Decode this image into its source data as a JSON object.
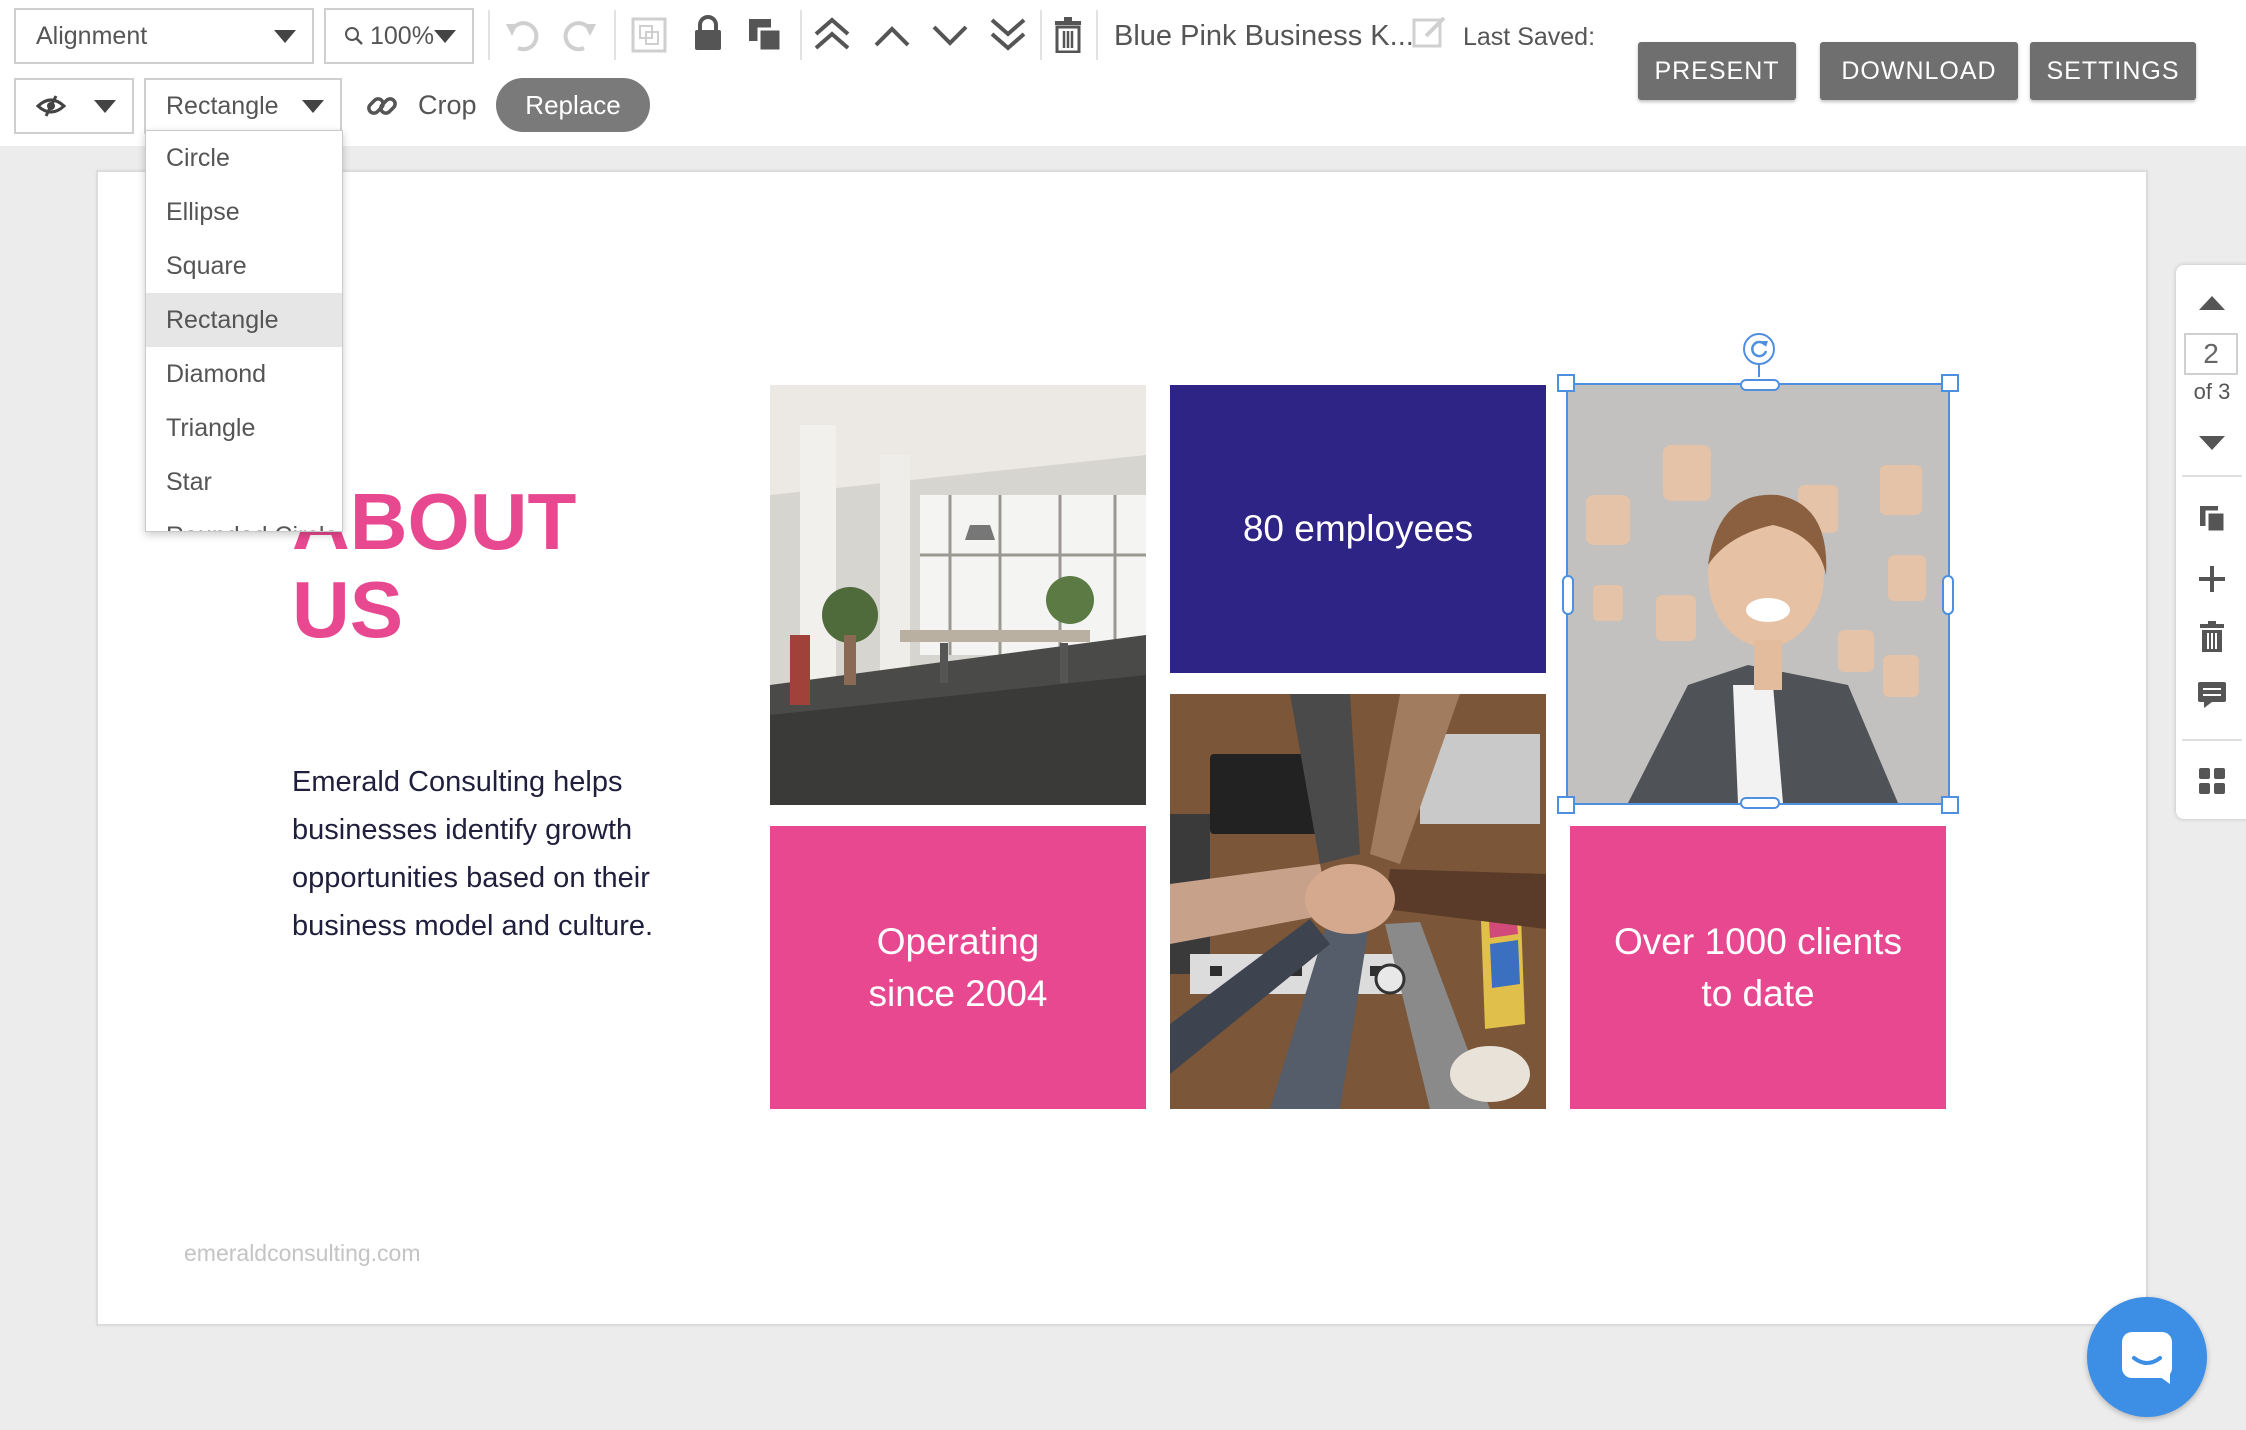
{
  "toolbar": {
    "alignment_label": "Alignment",
    "zoom_value": "100%",
    "doc_title": "Blue Pink Business K...",
    "last_saved_label": "Last Saved:",
    "present_label": "PRESENT",
    "download_label": "DOWNLOAD",
    "settings_label": "SETTINGS",
    "shape_value": "Rectangle",
    "crop_label": "Crop",
    "replace_label": "Replace"
  },
  "shape_menu": {
    "options": [
      "Circle",
      "Ellipse",
      "Square",
      "Rectangle",
      "Diamond",
      "Triangle",
      "Star",
      "Rounded Circle"
    ],
    "selected": "Rectangle"
  },
  "slide": {
    "title": "ABOUT US",
    "body": "Emerald Consulting helps businesses identify growth opportunities based on their business model and culture.",
    "footer": "emeraldconsulting.com",
    "tiles": {
      "employees": "80 employees",
      "operating_line1": "Operating",
      "operating_line2": "since 2004",
      "clients_line1": "Over 1000 clients",
      "clients_line2": "to date"
    }
  },
  "rail": {
    "current_page": "2",
    "of_label": "of 3"
  },
  "colors": {
    "accent_pink": "#e8488f",
    "navy": "#2e2486",
    "selection_blue": "#4f8fe0",
    "chat_blue": "#3d8fe6"
  }
}
